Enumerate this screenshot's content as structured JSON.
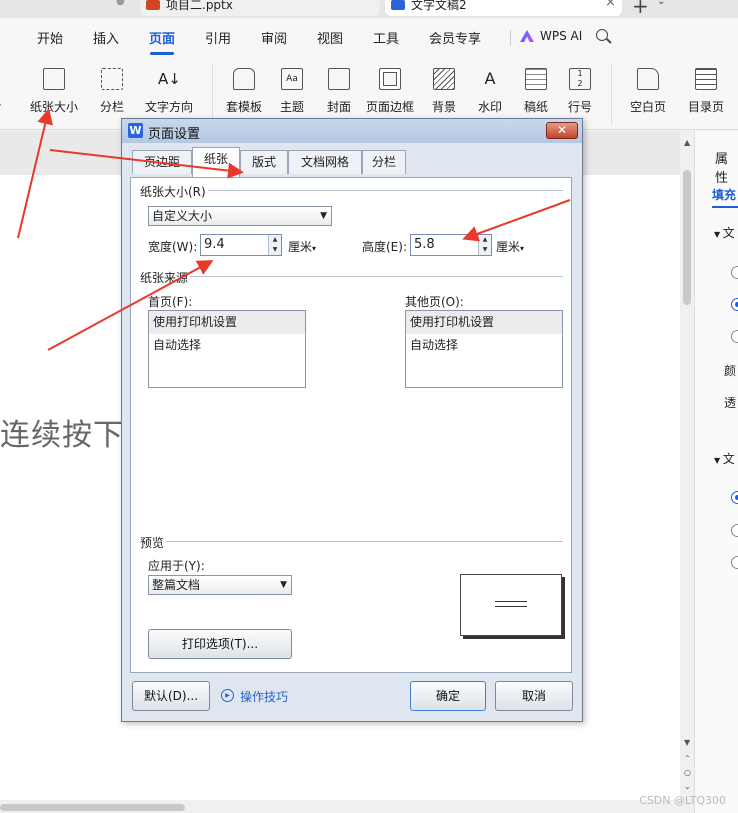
{
  "tabs": [
    {
      "title": "项目二.pptx",
      "icon": "ppt-icon"
    },
    {
      "title": "文字文稿2",
      "icon": "wps-doc-icon"
    }
  ],
  "new_tab_label": "+",
  "menu": [
    "开始",
    "插入",
    "页面",
    "引用",
    "审阅",
    "视图",
    "工具",
    "会员专享"
  ],
  "menu_active": "页面",
  "wps_ai": "WPS AI",
  "ribbon": [
    {
      "label": "纸张大小",
      "icon": "paper-size-icon"
    },
    {
      "label": "分栏",
      "icon": "columns-icon"
    },
    {
      "label": "文字方向",
      "icon": "text-direction-icon"
    },
    {
      "label": "套模板",
      "icon": "template-icon"
    },
    {
      "label": "主题",
      "icon": "theme-icon"
    },
    {
      "label": "封面",
      "icon": "cover-icon"
    },
    {
      "label": "页面边框",
      "icon": "page-border-icon"
    },
    {
      "label": "背景",
      "icon": "background-icon"
    },
    {
      "label": "水印",
      "icon": "watermark-icon"
    },
    {
      "label": "稿纸",
      "icon": "manuscript-icon"
    },
    {
      "label": "行号",
      "icon": "line-number-icon"
    },
    {
      "label": "空白页",
      "icon": "blank-page-icon"
    },
    {
      "label": "目录页",
      "icon": "toc-page-icon"
    }
  ],
  "document": {
    "text": "连续按下"
  },
  "right_panel": {
    "title": "属性",
    "tab": "填充",
    "section1": "文",
    "section2": "文",
    "row1": "颜",
    "row2": "透"
  },
  "dialog": {
    "title": "页面设置",
    "close": "✕",
    "tabs": [
      "页边距",
      "纸张",
      "版式",
      "文档网格",
      "分栏"
    ],
    "active_tab": "纸张",
    "paper_size_label": "纸张大小(R)",
    "paper_size_value": "自定义大小",
    "width_label": "宽度(W):",
    "width_value": "9.4",
    "height_label": "高度(E):",
    "height_value": "5.8",
    "unit": "厘米",
    "paper_source_label": "纸张来源",
    "first_page_label": "首页(F):",
    "other_pages_label": "其他页(O):",
    "source_options": [
      "使用打印机设置",
      "自动选择"
    ],
    "preview_label": "预览",
    "apply_to_label": "应用于(Y):",
    "apply_to_value": "整篇文档",
    "print_options": "打印选项(T)...",
    "default_btn": "默认(D)...",
    "tips_link": "操作技巧",
    "ok": "确定",
    "cancel": "取消"
  },
  "watermark": "CSDN @LTQ300",
  "colors": {
    "accent": "#1d5fd4",
    "annotation_arrow": "#e8392b"
  }
}
